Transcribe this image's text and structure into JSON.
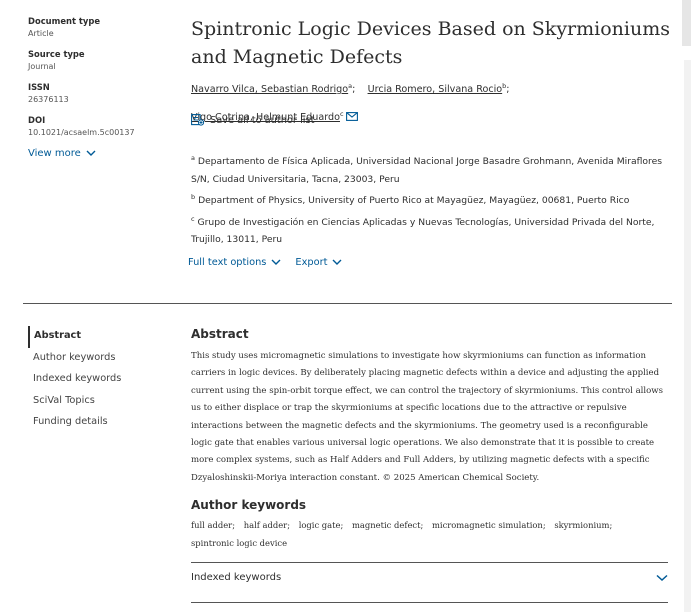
{
  "meta": {
    "items": [
      {
        "label": "Document type",
        "value": "Article"
      },
      {
        "label": "Source type",
        "value": "Journal"
      },
      {
        "label": "ISSN",
        "value": "26376113"
      },
      {
        "label": "DOI",
        "value": "10.1021/acsaelm.5c00137"
      }
    ],
    "view_more": "View more"
  },
  "title": "Spintronic Logic Devices Based on Skyrmioniums and Magnetic Defects",
  "authors": [
    {
      "name": "Navarro Vilca, Sebastian Rodrigo",
      "sup": "a",
      "sep": ";"
    },
    {
      "name": "Urcia Romero, Silvana Rocio",
      "sup": "b",
      "sep": ";"
    },
    {
      "name": "Vigo Cotrina, Helmunt Eduardo",
      "sup": "c",
      "sep": ""
    }
  ],
  "save_label": "Save all to author list",
  "affiliations": [
    {
      "sup": "a",
      "text": "Departamento de Física Aplicada, Universidad Nacional Jorge Basadre Grohmann, Avenida Miraflores S/N, Ciudad Universitaria, Tacna, 23003, Peru"
    },
    {
      "sup": "b",
      "text": "Department of Physics, University of Puerto Rico at Mayagüez, Mayagüez, 00681, Puerto Rico"
    },
    {
      "sup": "c",
      "text": "Grupo de Investigación en Ciencias Aplicadas y Nuevas Tecnologías, Universidad Privada del Norte, Trujillo, 13011, Peru"
    }
  ],
  "options": {
    "full_text": "Full text options",
    "export": "Export"
  },
  "nav": [
    "Abstract",
    "Author keywords",
    "Indexed keywords",
    "SciVal Topics",
    "Funding details"
  ],
  "abstract": {
    "heading": "Abstract",
    "text": "This study uses micromagnetic simulations to investigate how skyrmioniums can function as information carriers in logic devices. By deliberately placing magnetic defects within a device and adjusting the applied current using the spin-orbit torque effect, we can control the trajectory of skyrmioniums. This control allows us to either displace or trap the skyrmioniums at specific locations due to the attractive or repulsive interactions between the magnetic defects and the skyrmioniums. The geometry used is a reconfigurable logic gate that enables various universal logic operations. We also demonstrate that it is possible to create more complex systems, such as Half Adders and Full Adders, by utilizing magnetic defects with a specific Dzyaloshinskii-Moriya interaction constant. © 2025 American Chemical Society."
  },
  "author_keywords": {
    "heading": "Author keywords",
    "items": [
      "full adder;",
      "half adder;",
      "logic gate;",
      "magnetic defect;",
      "micromagnetic simulation;",
      "skyrmionium;",
      "spintronic logic device"
    ]
  },
  "indexed_keywords": {
    "heading": "Indexed keywords"
  },
  "colors": {
    "link": "#005a96",
    "text": "#2e2e2e"
  }
}
